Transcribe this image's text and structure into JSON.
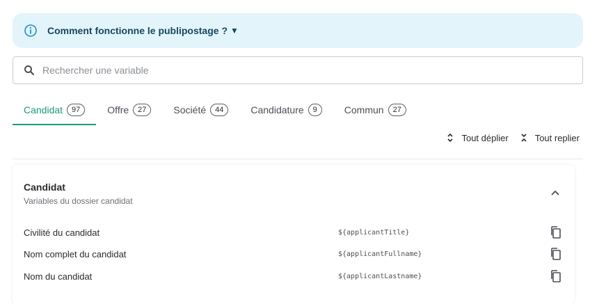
{
  "banner": {
    "text": "Comment fonctionne le publipostage ?",
    "caret": "▼"
  },
  "search": {
    "placeholder": "Rechercher une variable"
  },
  "tabs": [
    {
      "label": "Candidat",
      "count": "97",
      "active": true
    },
    {
      "label": "Offre",
      "count": "27"
    },
    {
      "label": "Société",
      "count": "44"
    },
    {
      "label": "Candidature",
      "count": "9"
    },
    {
      "label": "Commun",
      "count": "27"
    }
  ],
  "toolbar": {
    "expand_all": "Tout déplier",
    "collapse_all": "Tout replier"
  },
  "section": {
    "title": "Candidat",
    "subtitle": "Variables du dossier candidat",
    "rows": [
      {
        "label": "Civilité du candidat",
        "code": "${applicantTitle}"
      },
      {
        "label": "Nom complet du candidat",
        "code": "${applicantFullname}"
      },
      {
        "label": "Nom du candidat",
        "code": "${applicantLastname}"
      }
    ]
  },
  "colors": {
    "accent": "#1b9a7a",
    "banner_bg": "#e3f5fb",
    "banner_text": "#17475f",
    "info_icon": "#1a8fc7"
  }
}
